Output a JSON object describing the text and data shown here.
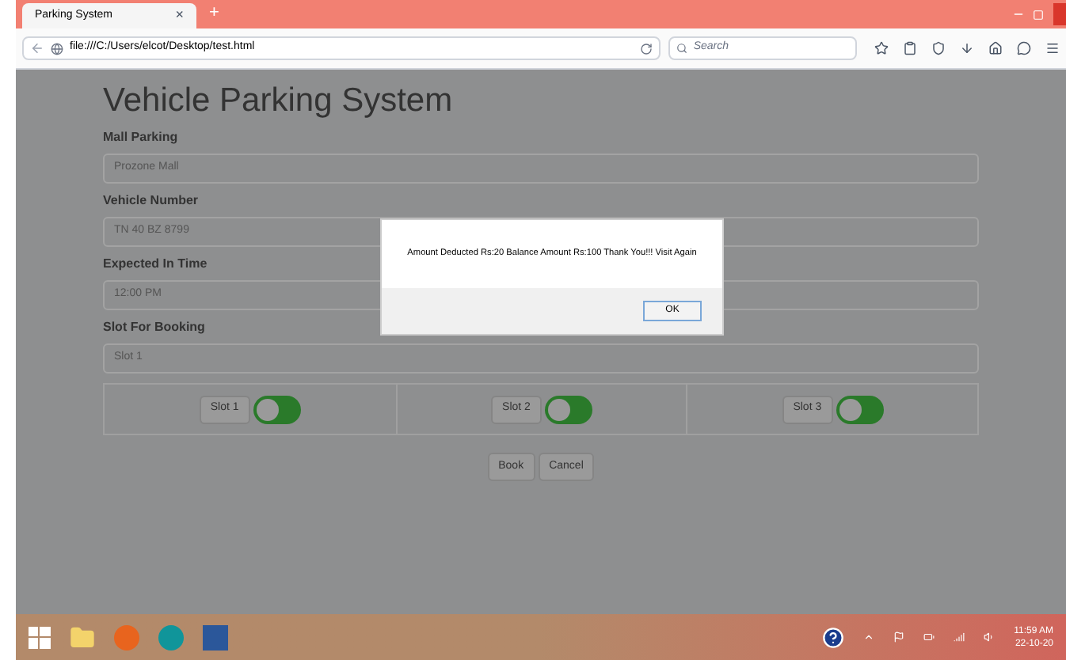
{
  "browser": {
    "tab_title": "Parking System",
    "tab_close": "×",
    "new_tab": "+",
    "url": "file:///C:/Users/elcot/Desktop/test.html",
    "search_placeholder": "Search"
  },
  "page": {
    "title": "Vehicle Parking System",
    "fields": [
      {
        "label": "Mall Parking",
        "value": "Prozone Mall"
      },
      {
        "label": "Vehicle Number",
        "value": "TN 40 BZ 8799"
      },
      {
        "label": "Expected In Time",
        "value": "12:00 PM"
      },
      {
        "label": "Slot For Booking",
        "value": "Slot 1"
      }
    ],
    "slots": [
      {
        "label": "Slot 1",
        "on": false
      },
      {
        "label": "Slot 2",
        "on": false
      },
      {
        "label": "Slot 3",
        "on": false
      }
    ],
    "buttons": [
      "Book",
      "Cancel"
    ]
  },
  "dialog": {
    "message": "Amount Deducted Rs:20 Balance Amount Rs:100 Thank You!!! Visit Again",
    "ok": "OK"
  },
  "taskbar": {
    "time": "11:59 AM",
    "date": "22-10-20"
  }
}
